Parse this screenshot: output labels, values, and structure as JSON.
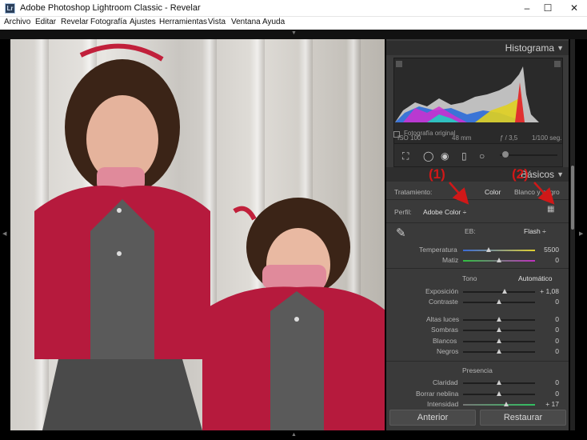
{
  "window": {
    "app_icon": "Lr",
    "title": "Adobe Photoshop Lightroom Classic - Revelar",
    "minimize": "–",
    "maximize": "☐",
    "close": "✕"
  },
  "menu": [
    "Archivo",
    "Editar",
    "Revelar",
    "Fotografía",
    "Ajustes",
    "Herramientas",
    "Vista",
    "Ventana",
    "Ayuda"
  ],
  "histogram": {
    "title": "Histograma",
    "iso": "ISO 100",
    "focal": "48 mm",
    "aperture": "ƒ / 3,5",
    "shutter": "1/100 seg.",
    "original_label": "Fotografía original"
  },
  "basic": {
    "title": "Básicos",
    "tratamiento_label": "Tratamiento:",
    "color_option": "Color",
    "bw_option": "Blanco y negro",
    "perfil_label": "Perfil:",
    "perfil_value": "Adobe Color ÷",
    "eb_label": "EB:",
    "eb_value": "Flash ÷",
    "temperatura_label": "Temperatura",
    "temperatura_value": "5500",
    "matiz_label": "Matiz",
    "matiz_value": "0",
    "tono_label": "Tono",
    "auto_label": "Automático",
    "exposicion_label": "Exposición",
    "exposicion_value": "+ 1,08",
    "contraste_label": "Contraste",
    "contraste_value": "0",
    "altas_label": "Altas luces",
    "altas_value": "0",
    "sombras_label": "Sombras",
    "sombras_value": "0",
    "blancos_label": "Blancos",
    "blancos_value": "0",
    "negros_label": "Negros",
    "negros_value": "0",
    "presencia_label": "Presencia",
    "claridad_label": "Claridad",
    "claridad_value": "0",
    "neblina_label": "Borrar neblina",
    "neblina_value": "0",
    "intensidad_label": "Intensidad",
    "intensidad_value": "+ 17"
  },
  "buttons": {
    "anterior": "Anterior",
    "restaurar": "Restaurar"
  },
  "annotations": {
    "one": "(1)",
    "two": "(2)"
  },
  "colors": {
    "accent_red": "#d01818",
    "panel_bg": "#3a3a3a"
  }
}
